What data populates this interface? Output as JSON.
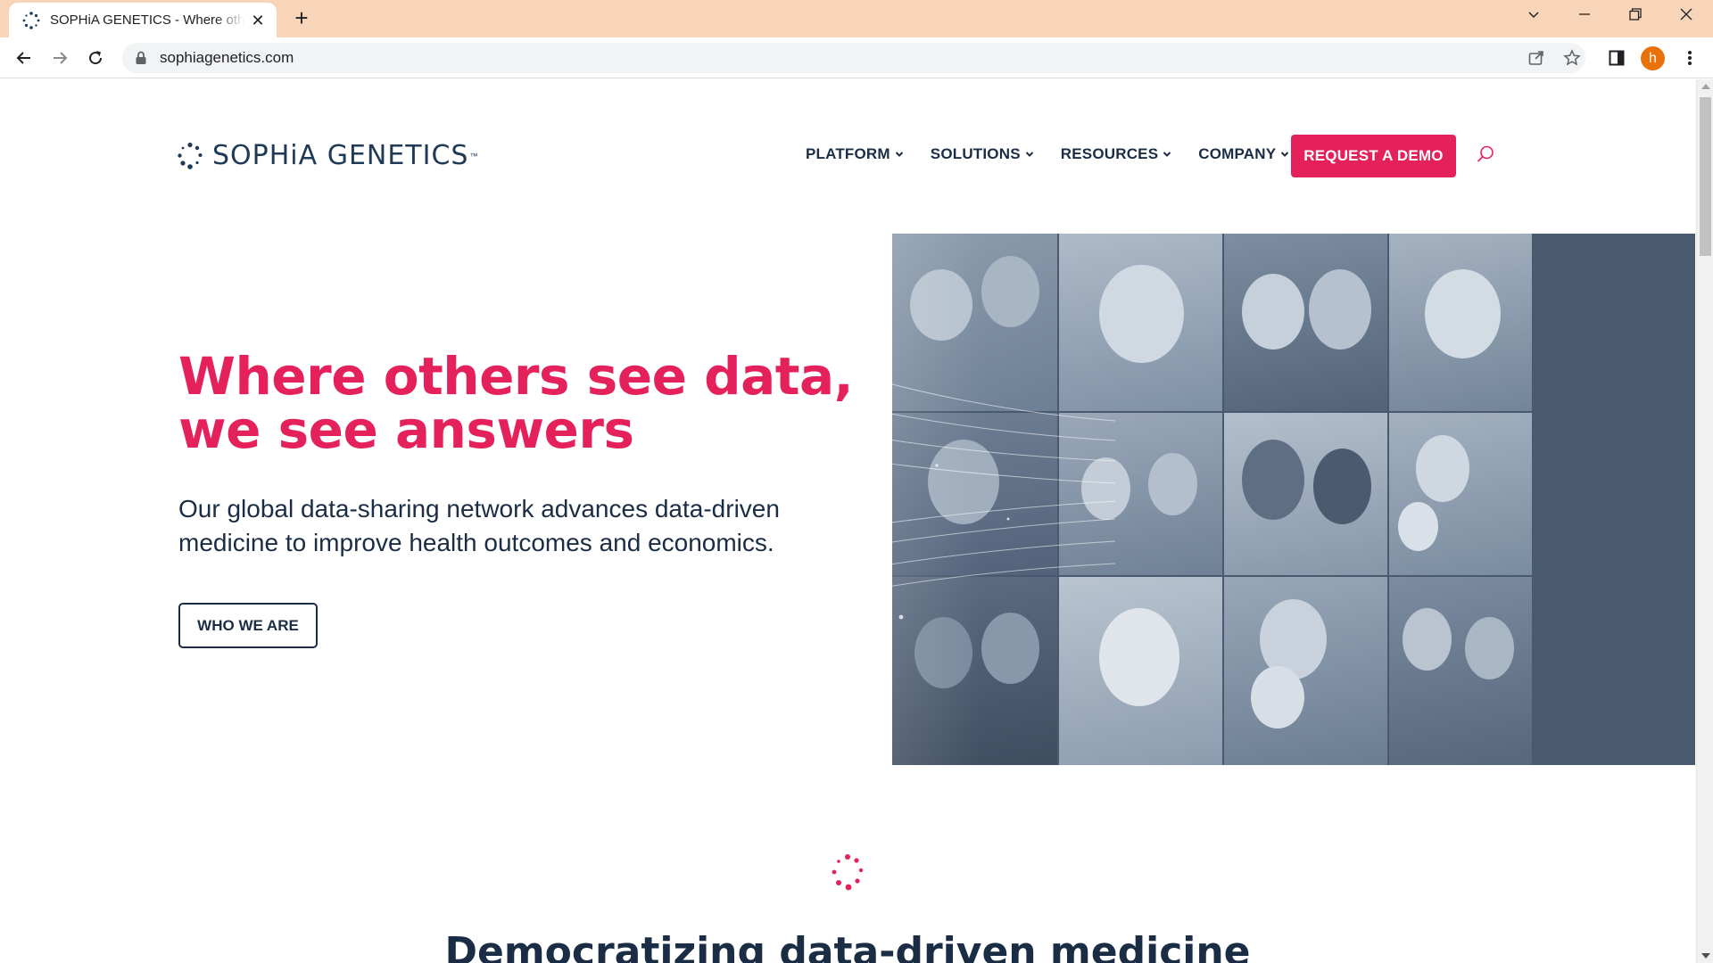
{
  "browser": {
    "tab_title": "SOPHiA GENETICS - Where others see data, we see answers",
    "url": "sophiagenetics.com",
    "profile_initial": "h"
  },
  "site": {
    "logo_text": "SOPHiA GENETICS",
    "logo_tm": "™",
    "nav": [
      {
        "label": "PLATFORM"
      },
      {
        "label": "SOLUTIONS"
      },
      {
        "label": "RESOURCES"
      },
      {
        "label": "COMPANY"
      }
    ],
    "cta_label": "REQUEST A DEMO",
    "colors": {
      "brand_pink": "#e5215b",
      "navy": "#1b2d45"
    }
  },
  "hero": {
    "title_line1": "Where others see data,",
    "title_line2": "we see answers",
    "subtitle": "Our global data-sharing network advances data-driven medicine to improve health outcomes and economics.",
    "button_label": "WHO WE ARE"
  },
  "section": {
    "title": "Democratizing data-driven medicine"
  }
}
